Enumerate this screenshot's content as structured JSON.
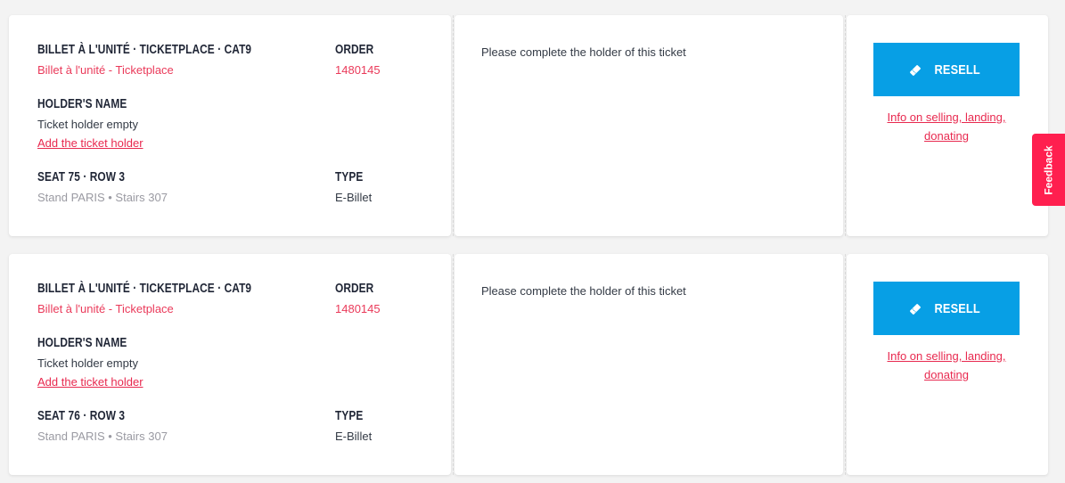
{
  "tickets": [
    {
      "title": "BILLET À L'UNITÉ · TICKETPLACE · CAT9",
      "subtitle": "Billet à l'unité - Ticketplace",
      "order_label": "ORDER",
      "order_number": "1480145",
      "holder_label": "HOLDER'S NAME",
      "holder_value": "Ticket holder empty",
      "add_holder_link": "Add the ticket holder",
      "seat_label": "SEAT 75 · ROW 3",
      "seat_location": "Stand PARIS • Stairs 307",
      "type_label": "TYPE",
      "type_value": "E-Billet",
      "message": "Please complete the holder of this ticket",
      "resell_label": "RESELL",
      "info_link_line1": "Info on selling, landing,",
      "info_link_line2": "donating"
    },
    {
      "title": "BILLET À L'UNITÉ · TICKETPLACE · CAT9",
      "subtitle": "Billet à l'unité - Ticketplace",
      "order_label": "ORDER",
      "order_number": "1480145",
      "holder_label": "HOLDER'S NAME",
      "holder_value": "Ticket holder empty",
      "add_holder_link": "Add the ticket holder",
      "seat_label": "SEAT 76 · ROW 3",
      "seat_location": "Stand PARIS • Stairs 307",
      "type_label": "TYPE",
      "type_value": "E-Billet",
      "message": "Please complete the holder of this ticket",
      "resell_label": "RESELL",
      "info_link_line1": "Info on selling, landing,",
      "info_link_line2": "donating"
    }
  ],
  "feedback_tab": "Feedback",
  "colors": {
    "accent_red": "#e8294f",
    "resell_blue": "#079fe5",
    "feedback_red": "#ff1f4f",
    "heading": "#1f2535"
  },
  "icons": {
    "resell": "ticket-icon"
  }
}
